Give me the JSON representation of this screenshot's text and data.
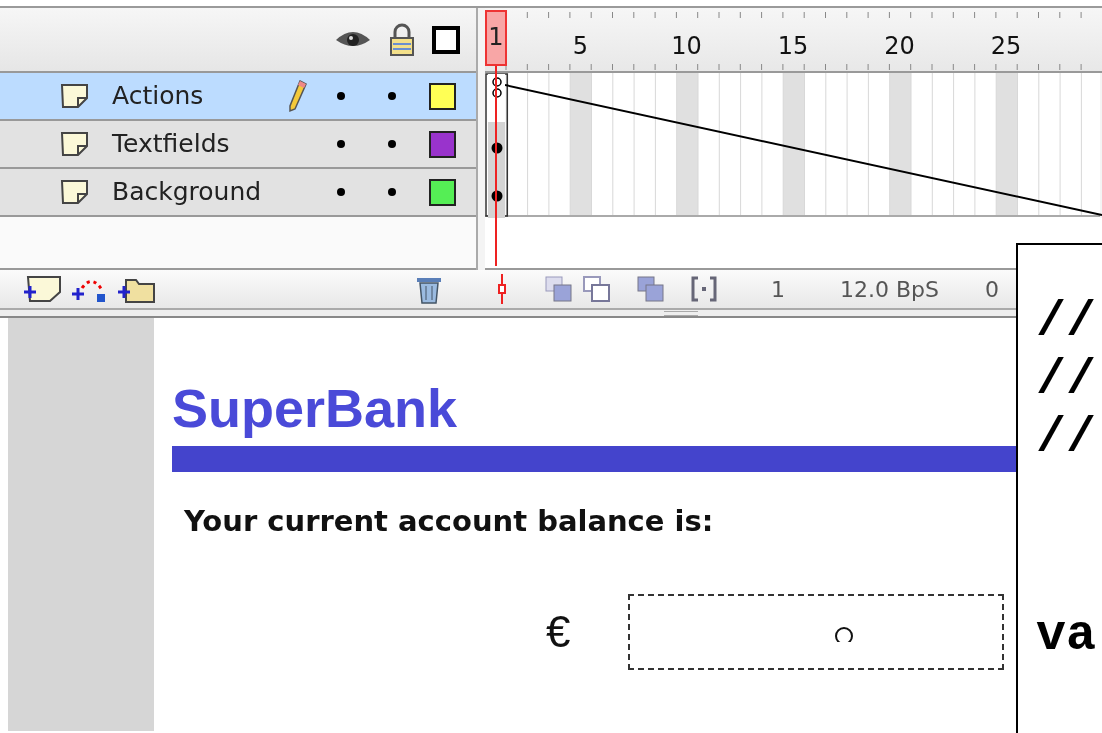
{
  "ruler": {
    "current_frame": "1",
    "labels": [
      "5",
      "10",
      "15",
      "20",
      "25"
    ]
  },
  "layers": [
    {
      "name": "Actions",
      "selected": true,
      "editing": true,
      "color": "#ffff55",
      "keyframe_filled": false
    },
    {
      "name": "Textfields",
      "selected": false,
      "editing": false,
      "color": "#9933cc",
      "keyframe_filled": true
    },
    {
      "name": "Background",
      "selected": false,
      "editing": false,
      "color": "#55ee55",
      "keyframe_filled": true
    }
  ],
  "status_bar": {
    "current_frame": "1",
    "frame_rate": "12.0 BpS",
    "elapsed": "0"
  },
  "stage": {
    "title": "SuperBank",
    "prompt": "Your current account balance is:",
    "currency": "€"
  },
  "code_callout": {
    "comment_lines": [
      "//",
      "//",
      "//"
    ],
    "code_lines": [
      "va"
    ]
  }
}
